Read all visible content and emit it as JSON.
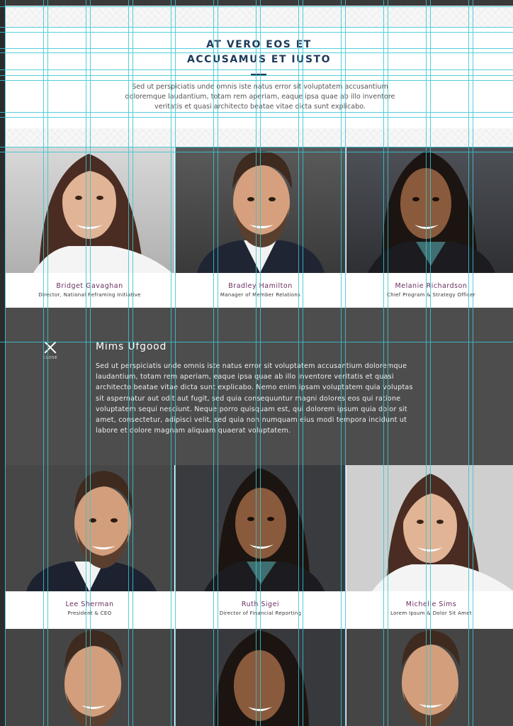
{
  "header": {
    "title_line1": "AT VERO EOS ET",
    "title_line2": "ACCUSAMUS ET IUSTO",
    "intro": "Sed ut perspiciatis unde omnis iste natus error sit voluptatem accusantium doloremque laudantium, totam rem aperiam, eaque ipsa quae ab illo inventore veritatis et quasi architecto beatae vitae dicta sunt explicabo."
  },
  "team_row1": [
    {
      "name": "Bridget Gavaghan",
      "role": "Director, National Reframing Initiative",
      "portrait": "female-portrait-light-bg"
    },
    {
      "name": "Bradley Hamilton",
      "role": "Manager of Member Relations",
      "portrait": "male-portrait-dark-bg"
    },
    {
      "name": "Melanie Richardson",
      "role": "Chief Program & Strategy Officer",
      "portrait": "female-portrait-dark-bg"
    }
  ],
  "detail": {
    "close_label": "CLOSE",
    "name": "Mims Ufgood",
    "bio": "Sed ut perspiciatis unde omnis iste natus error sit voluptatem accusantium doloremque laudantium, totam rem aperiam, eaque ipsa quae ab illo inventore veritatis et quasi architecto beatae vitae dicta sunt explicabo. Nemo enim ipsam voluptatem quia voluptas sit aspernatur aut odit aut fugit, sed quia consequuntur magni dolores eos qui ratione voluptatem sequi nesciunt. Neque porro quisquam est, qui dolorem ipsum quia dolor sit amet, consectetur, adipisci velit, sed quia non numquam eius modi tempora incidunt ut labore et dolore magnam aliquam quaerat voluptatem."
  },
  "team_row2": [
    {
      "name": "Lee Sherman",
      "role": "President & CEO",
      "portrait": "male-portrait-dark-bg"
    },
    {
      "name": "Ruth Sigei",
      "role": "Director of Financial Reporting",
      "portrait": "female-portrait-dark-bg"
    },
    {
      "name": "Michelle Sims",
      "role": "Lorem Ipsum & Dolor Sit Amet",
      "portrait": "female-portrait-light-bg"
    }
  ],
  "team_row3": [
    {
      "portrait": "male-portrait-dark-bg"
    },
    {
      "portrait": "female-portrait-dark-bg"
    },
    {
      "portrait": "male-portrait-dark-bg"
    }
  ],
  "colors": {
    "title": "#1d3a5a",
    "name_accent": "#6a2d5f",
    "detail_bg": "#4d4d4d",
    "guide": "#37c6d6"
  }
}
